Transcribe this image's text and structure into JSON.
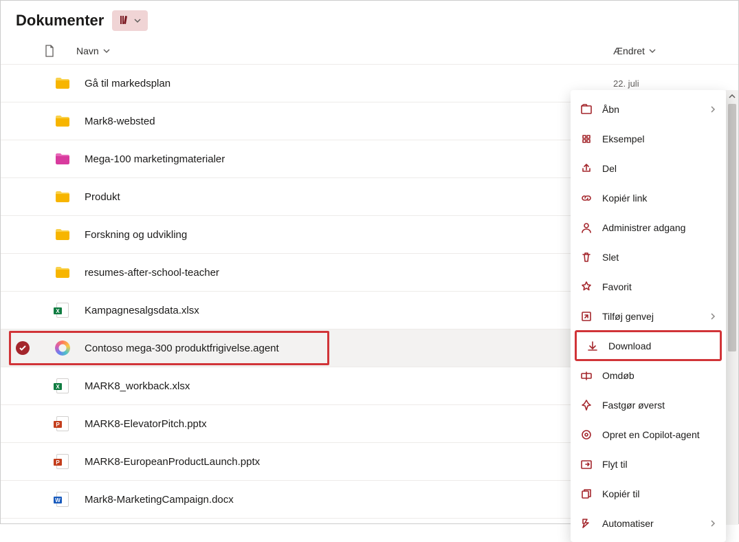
{
  "header": {
    "title": "Dokumenter"
  },
  "columns": {
    "name": "Navn",
    "modified": "Ændret"
  },
  "files": [
    {
      "icon": "folder",
      "name": "Gå til markedsplan",
      "modified": "22. juli"
    },
    {
      "icon": "folder",
      "name": "Mark8-websted",
      "modified": ""
    },
    {
      "icon": "folder-pink",
      "name": "Mega-100 marketingmaterialer",
      "modified": ""
    },
    {
      "icon": "folder",
      "name": "Produkt",
      "modified": ""
    },
    {
      "icon": "folder",
      "name": "Forskning og udvikling",
      "modified": ""
    },
    {
      "icon": "folder",
      "name": "resumes-after-school-teacher",
      "modified": ""
    },
    {
      "icon": "excel",
      "name": "Kampagnesalgsdata.xlsx",
      "modified": ""
    },
    {
      "icon": "copilot",
      "name": "Contoso mega-300 produktfrigivelse.agent",
      "modified": "",
      "selected": true,
      "actions": "···"
    },
    {
      "icon": "excel",
      "name": "MARK8_workback.xlsx",
      "modified": ""
    },
    {
      "icon": "powerpoint",
      "name": "MARK8-ElevatorPitch.pptx",
      "modified": ""
    },
    {
      "icon": "powerpoint",
      "name": "MARK8-EuropeanProductLaunch.pptx",
      "modified": ""
    },
    {
      "icon": "word",
      "name": "Mark8-MarketingCampaign.docx",
      "modified": ""
    }
  ],
  "menu": [
    {
      "icon": "open",
      "label": "Åbn",
      "submenu": true
    },
    {
      "icon": "preview",
      "label": "Eksempel"
    },
    {
      "icon": "share",
      "label": "Del"
    },
    {
      "icon": "link",
      "label": "Kopiér link"
    },
    {
      "icon": "access",
      "label": "Administrer adgang"
    },
    {
      "icon": "delete",
      "label": "Slet"
    },
    {
      "icon": "favorite",
      "label": "Favorit"
    },
    {
      "icon": "shortcut",
      "label": "Tilføj genvej",
      "submenu": true
    },
    {
      "icon": "download",
      "label": "Download",
      "highlight": true
    },
    {
      "icon": "rename",
      "label": "Omdøb"
    },
    {
      "icon": "pin",
      "label": "Fastgør øverst"
    },
    {
      "icon": "copilot-agent",
      "label": "Opret en Copilot-agent"
    },
    {
      "icon": "move",
      "label": "Flyt til"
    },
    {
      "icon": "copy",
      "label": "Kopiér til"
    },
    {
      "icon": "automate",
      "label": "Automatiser",
      "submenu": true
    }
  ]
}
